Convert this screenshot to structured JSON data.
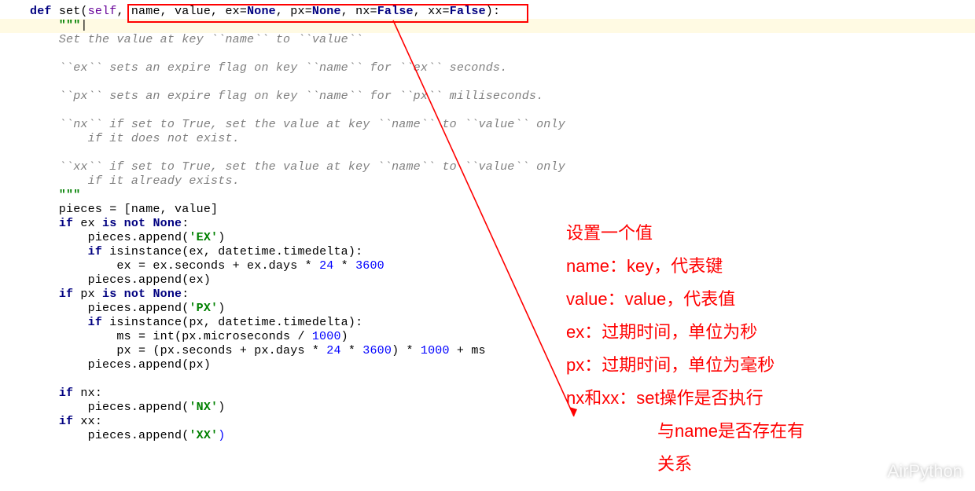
{
  "def_kw": "def ",
  "func_name": "set",
  "paren_open": "(",
  "self_kw": "self",
  "after_self": ", name, value, ex=",
  "none1": "None",
  "after_ex": ", px=",
  "none2": "None",
  "after_px": ", nx=",
  "false1": "False",
  "after_nx": ", xx=",
  "false2": "False",
  "paren_close": "):",
  "triple_open": "    \"\"\"",
  "doc1": "    Set the value at key ``name`` to ``value``",
  "doc_blank": "",
  "doc2": "    ``ex`` sets an expire flag on key ``name`` for ``ex`` seconds.",
  "doc3": "    ``px`` sets an expire flag on key ``name`` for ``px`` milliseconds.",
  "doc4": "    ``nx`` if set to True, set the value at key ``name`` to ``value`` only",
  "doc4b": "        if it does not exist.",
  "doc5": "    ``xx`` if set to True, set the value at key ``name`` to ``value`` only",
  "doc5b": "        if it already exists.",
  "triple_close": "    \"\"\"",
  "line_pieces": "    pieces = [name, value]",
  "if_ex_pre": "    ",
  "if_kw": "if",
  "is_kw": " is not ",
  "none_kw": "None",
  "colon": ":",
  "ex_name": " ex ",
  "append_ex": "        pieces.append(",
  "str_ex": "'EX'",
  "paren": ")",
  "isinst_ex_pre": "        ",
  "isinst": " isinstance(ex, datetime.timedelta):",
  "ex_assign": "            ex = ex.seconds + ex.days * ",
  "n24": "24",
  "mul": " * ",
  "n3600": "3600",
  "append_ex2": "        pieces.append(ex)",
  "px_name": " px ",
  "append_px": "        pieces.append(",
  "str_px": "'PX'",
  "isinst_px": " isinstance(px, datetime.timedelta):",
  "ms_assign": "            ms = int(px.microseconds / ",
  "n1000": "1000",
  "px_assign": "            px = (px.seconds + px.days * ",
  "mul2": ") * ",
  "plus": " + ms",
  "append_px2": "        pieces.append(px)",
  "if_nx": " nx:",
  "append_nx": "        pieces.append(",
  "str_nx": "'NX'",
  "if_xx": " xx:",
  "append_xx": "        pieces.append(",
  "str_xx": "'XX'",
  "annotations": {
    "a1": "设置一个值",
    "a2": "name：key，代表键",
    "a3": "value：value，代表值",
    "a4": "ex：过期时间，单位为秒",
    "a5": "px：过期时间，单位为毫秒",
    "a6": "nx和xx：set操作是否执行",
    "a7": "与name是否存在有",
    "a8": "关系"
  },
  "watermark": "AirPython",
  "caret": "|"
}
